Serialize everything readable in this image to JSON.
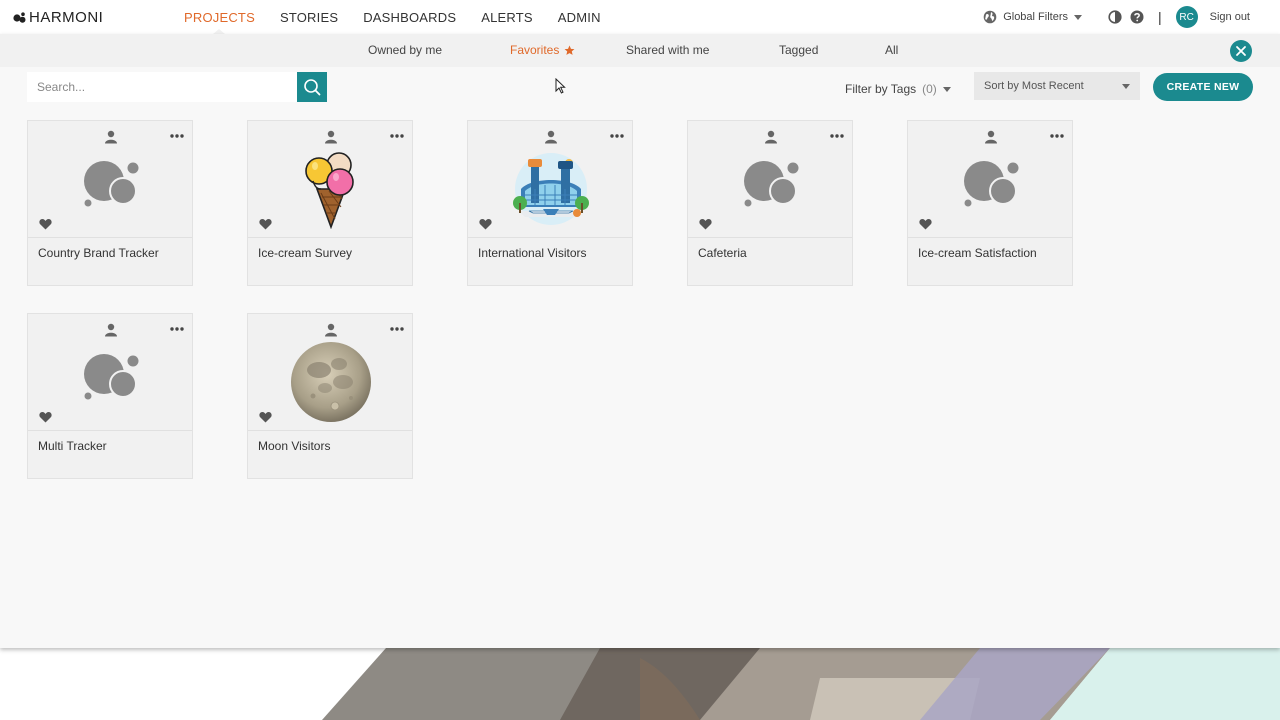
{
  "brand": {
    "name": "HARMONI"
  },
  "nav": {
    "items": [
      {
        "label": "PROJECTS",
        "active": true
      },
      {
        "label": "STORIES",
        "active": false
      },
      {
        "label": "DASHBOARDS",
        "active": false
      },
      {
        "label": "ALERTS",
        "active": false
      },
      {
        "label": "ADMIN",
        "active": false
      }
    ]
  },
  "header": {
    "global_filters_label": "Global Filters",
    "separator": "|",
    "avatar_initials": "RC",
    "signout_label": "Sign out"
  },
  "subtabs": [
    {
      "label": "Owned by me",
      "active": false
    },
    {
      "label": "Favorites",
      "active": true,
      "icon": "star-icon"
    },
    {
      "label": "Shared with me",
      "active": false
    },
    {
      "label": "Tagged",
      "active": false
    },
    {
      "label": "All",
      "active": false
    }
  ],
  "toolbar": {
    "search_placeholder": "Search...",
    "search_value": "",
    "filter_tags_label": "Filter by Tags",
    "filter_tags_count": "(0)",
    "sort_label": "Sort by Most Recent",
    "create_label": "CREATE NEW"
  },
  "colors": {
    "accent": "#e0692a",
    "teal": "#1b8a8f",
    "panel_bg": "#f8f8f8",
    "card_bg": "#f1f1f1"
  },
  "projects": [
    {
      "title": "Country Brand Tracker",
      "thumbnail": "placeholder-bubbles-icon"
    },
    {
      "title": "Ice-cream Survey",
      "thumbnail": "ice-cream-icon"
    },
    {
      "title": "International Visitors",
      "thumbnail": "airport-illustration"
    },
    {
      "title": "Cafeteria",
      "thumbnail": "placeholder-bubbles-icon"
    },
    {
      "title": "Ice-cream Satisfaction",
      "thumbnail": "placeholder-bubbles-icon"
    },
    {
      "title": "Multi Tracker",
      "thumbnail": "placeholder-bubbles-icon"
    },
    {
      "title": "Moon Visitors",
      "thumbnail": "moon-image"
    }
  ]
}
